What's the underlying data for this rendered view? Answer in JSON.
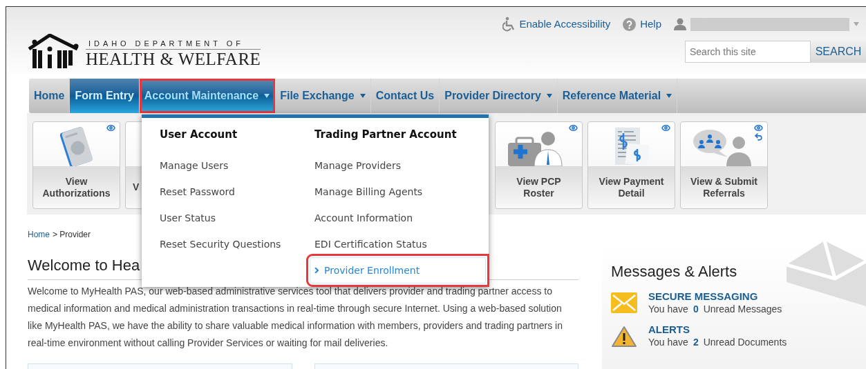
{
  "header": {
    "logo_top": "IDAHO DEPARTMENT OF",
    "logo_main": "HEALTH & WELFARE",
    "links": [
      {
        "kind": "accessibility",
        "label": "Enable Accessibility"
      },
      {
        "kind": "help",
        "label": "Help"
      }
    ],
    "search": {
      "placeholder": "Search this site",
      "button": "SEARCH"
    }
  },
  "nav": [
    {
      "label": "Home",
      "selected": false,
      "expanded": false,
      "dropdown": false,
      "annotated": false
    },
    {
      "label": "Form Entry",
      "selected": true,
      "expanded": false,
      "dropdown": false,
      "annotated": false
    },
    {
      "label": "Account Maintenance",
      "selected": false,
      "expanded": true,
      "dropdown": true,
      "annotated": true
    },
    {
      "label": "File Exchange",
      "selected": false,
      "expanded": false,
      "dropdown": true,
      "annotated": false
    },
    {
      "label": "Contact Us",
      "selected": false,
      "expanded": false,
      "dropdown": false,
      "annotated": false
    },
    {
      "label": "Provider Directory",
      "selected": false,
      "expanded": false,
      "dropdown": true,
      "annotated": false
    },
    {
      "label": "Reference Material",
      "selected": false,
      "expanded": false,
      "dropdown": true,
      "annotated": false
    }
  ],
  "menu": {
    "columns": [
      {
        "heading": "User Account",
        "items": [
          {
            "label": "Manage Users",
            "selected": false,
            "annotated": false
          },
          {
            "label": "Reset Password",
            "selected": false,
            "annotated": false
          },
          {
            "label": "User Status",
            "selected": false,
            "annotated": false
          },
          {
            "label": "Reset Security Questions",
            "selected": false,
            "annotated": false
          }
        ]
      },
      {
        "heading": "Trading Partner Account",
        "items": [
          {
            "label": "Manage Providers",
            "selected": false,
            "annotated": false
          },
          {
            "label": "Manage Billing Agents",
            "selected": false,
            "annotated": false
          },
          {
            "label": "Account Information",
            "selected": false,
            "annotated": false
          },
          {
            "label": "EDI Certification Status",
            "selected": false,
            "annotated": false
          },
          {
            "label": "Provider Enrollment",
            "selected": true,
            "annotated": true
          }
        ]
      }
    ]
  },
  "tiles": [
    {
      "kind": "authorization",
      "lines": [
        "View",
        "Authorizations"
      ],
      "refresh": false
    },
    {
      "kind": "covered",
      "lines": [
        "V"
      ],
      "refresh": false
    },
    {
      "kind": "roster",
      "lines": [
        "View PCP",
        "Roster"
      ],
      "refresh": false
    },
    {
      "kind": "payment",
      "lines": [
        "View Payment",
        "Detail"
      ],
      "refresh": false
    },
    {
      "kind": "referral",
      "lines": [
        "View & Submit",
        "Referrals"
      ],
      "refresh": true
    }
  ],
  "breadcrumb": [
    {
      "label": "Home",
      "link": true
    },
    {
      "label": "> Provider",
      "link": false
    }
  ],
  "welcome": {
    "title": "Welcome to Hea",
    "text": "Welcome to MyHealth PAS, our web-based administrative services tool that delivers provider and trading partner access to medical information and medical administration transactions in real-time through secure Internet. Using a web-based solution like MyHealth PAS, we have the ability to share valuable medical information with members, providers and trading partners in real-time environment without calling Provider Services or waiting for mail deliveries."
  },
  "alerts": {
    "title": "Messages & Alerts",
    "items": [
      {
        "kind": "message",
        "title": "SECURE MESSAGING",
        "prefix": "You have",
        "count": "0",
        "suffix": "Unread Messages"
      },
      {
        "kind": "alert",
        "title": "ALERTS",
        "prefix": "You have",
        "count": "2",
        "suffix": "Unread Documents"
      }
    ]
  }
}
